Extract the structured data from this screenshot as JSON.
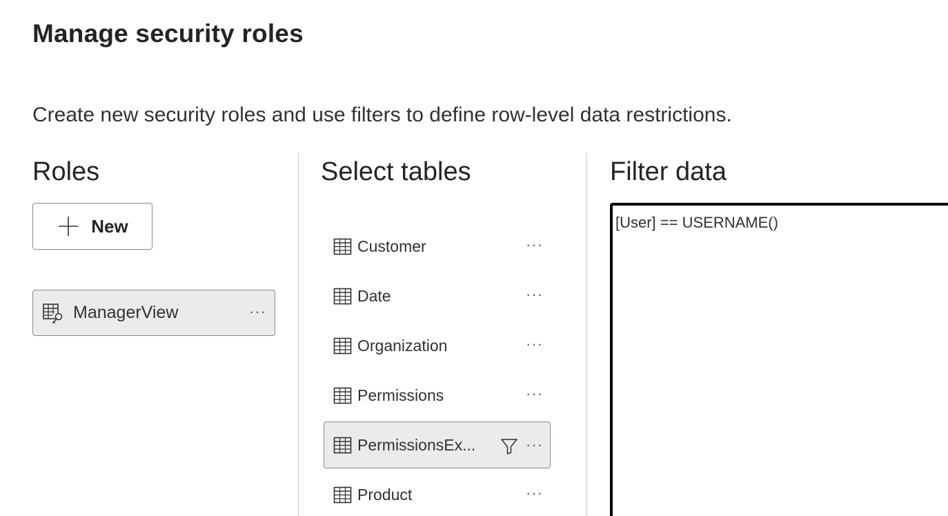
{
  "page": {
    "title": "Manage security roles",
    "subtitle": "Create new security roles and use filters to define row-level data restrictions."
  },
  "roles": {
    "heading": "Roles",
    "new_button_label": "New",
    "items": [
      {
        "label": "ManagerView",
        "more": "···"
      }
    ]
  },
  "tables": {
    "heading": "Select tables",
    "items": [
      {
        "label": "Customer",
        "more": "···"
      },
      {
        "label": "Date",
        "more": "···"
      },
      {
        "label": "Organization",
        "more": "···"
      },
      {
        "label": "Permissions",
        "more": "···"
      },
      {
        "label": "PermissionsEx...",
        "more": "···",
        "selected": true,
        "has_filter": true
      },
      {
        "label": "Product",
        "more": "···"
      }
    ]
  },
  "filter": {
    "heading": "Filter data",
    "expression": "[User] == USERNAME()"
  },
  "icons": {
    "new": "plus-icon",
    "role": "table-key-icon",
    "table": "table-icon",
    "filter": "filter-icon"
  },
  "colors": {
    "selected_bg": "#edebe9",
    "border": "#8a8886",
    "editor_border": "#000000"
  }
}
